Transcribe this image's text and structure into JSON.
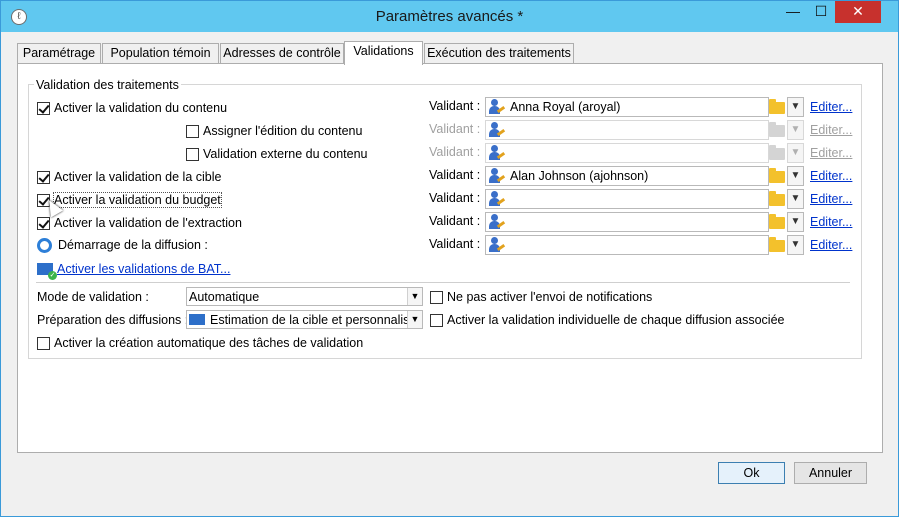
{
  "window": {
    "title": "Paramètres avancés *",
    "minimize": "—",
    "maximize": "☐",
    "close": "✕",
    "app_icon": "ℓ"
  },
  "tabs": [
    {
      "label": "Paramétrage"
    },
    {
      "label": "Population témoin"
    },
    {
      "label": "Adresses de contrôle"
    },
    {
      "label": "Validations",
      "active": true
    },
    {
      "label": "Exécution des traitements"
    }
  ],
  "validation": {
    "group_title": "Validation des traitements",
    "validant_label": "Validant :",
    "edit_label": "Editer...",
    "rows": [
      {
        "label": "Activer la validation du contenu",
        "checked": true,
        "validant": "Anna Royal (aroyal)",
        "disabled": false
      },
      {
        "label": "Assigner l'édition du contenu",
        "checked": false,
        "validant": "",
        "disabled": true
      },
      {
        "label": "Validation externe du contenu",
        "checked": false,
        "validant": "",
        "disabled": true
      },
      {
        "label": "Activer la validation de la cible",
        "checked": true,
        "validant": "Alan Johnson (ajohnson)",
        "disabled": false
      },
      {
        "label": "Activer la validation du budget",
        "checked": true,
        "validant": "",
        "disabled": false
      },
      {
        "label": "Activer la validation de l'extraction",
        "checked": true,
        "validant": "",
        "disabled": false
      },
      {
        "label": "Démarrage de la diffusion :",
        "validant": "",
        "disabled": false
      }
    ],
    "bat_link": "Activer les validations de BAT..."
  },
  "settings": {
    "mode_label": "Mode de validation :",
    "mode_value": "Automatique",
    "prep_label": "Préparation des diffusions :",
    "prep_value": "Estimation de la cible et personnalisat",
    "no_notif_label": "Ne pas activer l'envoi de notifications",
    "no_notif_checked": false,
    "individual_label": "Activer la validation individuelle de chaque diffusion associée",
    "individual_checked": false,
    "auto_tasks_label": "Activer la création automatique des tâches de validation",
    "auto_tasks_checked": false
  },
  "buttons": {
    "ok": "Ok",
    "cancel": "Annuler"
  },
  "icons": {
    "user": "user-key-icon",
    "folder": "folder-icon",
    "diffusion": "delivery-start-icon",
    "bat": "bat-mail-icon",
    "mail": "mail-icon"
  }
}
